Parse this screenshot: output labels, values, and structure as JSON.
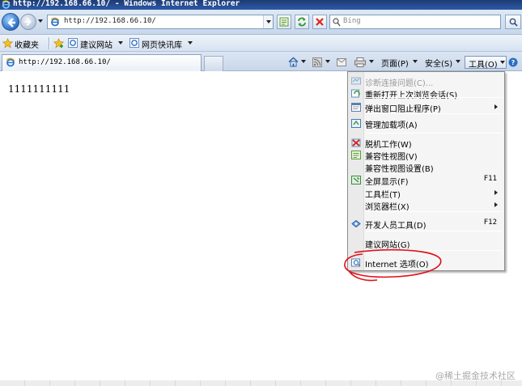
{
  "window": {
    "title": "http://192.168.66.10/ - Windows Internet Explorer"
  },
  "address_bar": {
    "url": "http://192.168.66.10/"
  },
  "search": {
    "placeholder": "Bing"
  },
  "favorites_bar": {
    "favorites_label": "收藏夹",
    "items": [
      {
        "label": "建议网站"
      },
      {
        "label": "网页快讯库"
      }
    ]
  },
  "tab": {
    "label": "http://192.168.66.10/"
  },
  "command_bar": {
    "page": "页面(P)",
    "safety": "安全(S)",
    "tools": "工具(O)"
  },
  "content": {
    "text": "1111111111"
  },
  "tools_menu": {
    "items": [
      {
        "label": "诊断连接问题(C)...",
        "shortcut": "",
        "disabled": true,
        "submenu": false,
        "icon": "diagnose-icon"
      },
      {
        "label": "重新打开上次浏览会话(S)",
        "shortcut": "",
        "disabled": false,
        "submenu": false,
        "icon": "reopen-session-icon"
      },
      {
        "label": "弹出窗口阻止程序(P)",
        "shortcut": "",
        "disabled": false,
        "submenu": true,
        "icon": "popup-blocker-icon"
      },
      {
        "label": "管理加载项(A)",
        "shortcut": "",
        "disabled": false,
        "submenu": false,
        "icon": "addons-icon"
      },
      {
        "label": "脱机工作(W)",
        "shortcut": "",
        "disabled": false,
        "submenu": false,
        "icon": "offline-icon"
      },
      {
        "label": "兼容性视图(V)",
        "shortcut": "",
        "disabled": false,
        "submenu": false,
        "icon": "compat-view-icon"
      },
      {
        "label": "兼容性视图设置(B)",
        "shortcut": "",
        "disabled": false,
        "submenu": false,
        "icon": ""
      },
      {
        "label": "全屏显示(F)",
        "shortcut": "F11",
        "disabled": false,
        "submenu": false,
        "icon": "fullscreen-icon"
      },
      {
        "label": "工具栏(T)",
        "shortcut": "",
        "disabled": false,
        "submenu": true,
        "icon": ""
      },
      {
        "label": "浏览器栏(X)",
        "shortcut": "",
        "disabled": false,
        "submenu": true,
        "icon": ""
      },
      {
        "label": "开发人员工具(D)",
        "shortcut": "F12",
        "disabled": false,
        "submenu": false,
        "icon": "developer-tools-icon"
      },
      {
        "label": "建议网站(G)",
        "shortcut": "",
        "disabled": false,
        "submenu": false,
        "icon": ""
      },
      {
        "label": "Internet 选项(O)",
        "shortcut": "",
        "disabled": false,
        "submenu": false,
        "icon": "internet-options-icon"
      }
    ]
  },
  "watermark": {
    "text": "@稀土掘金技术社区"
  },
  "colors": {
    "titlebar": "#1d3b73",
    "annotation": "#e0101a",
    "menu_bg": "#f5f5f5"
  }
}
